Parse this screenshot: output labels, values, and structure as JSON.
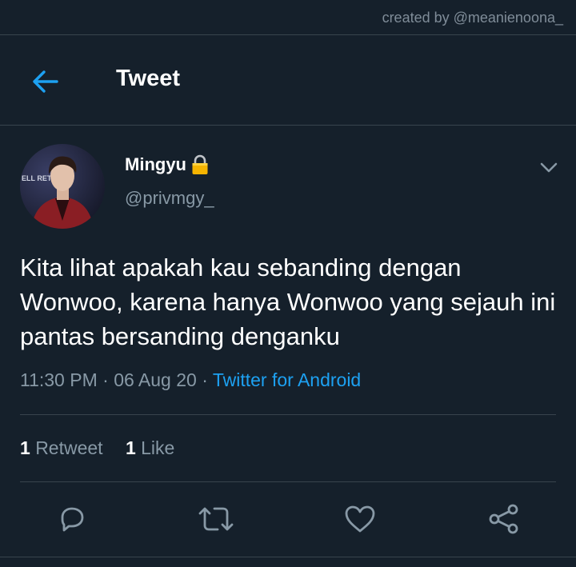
{
  "watermark": "created by @meanienoona_",
  "header": {
    "title": "Tweet",
    "back_icon": "arrow-left-icon"
  },
  "user": {
    "name": "Mingyu",
    "badge_icon": "lock-icon",
    "handle": "@privmgy_",
    "avatar_backdrop_text": "ELL RETU"
  },
  "tweet": {
    "text": "Kita lihat apakah kau sebanding dengan Wonwoo, karena hanya Wonwoo yang sejauh ini pantas bersanding denganku",
    "time": "11:30 PM",
    "date": "06 Aug 20",
    "separator": "·",
    "source": "Twitter for Android"
  },
  "stats": {
    "retweets_count": "1",
    "retweets_label": "Retweet",
    "likes_count": "1",
    "likes_label": "Like"
  },
  "actions": [
    "reply-icon",
    "retweet-icon",
    "like-icon",
    "share-icon"
  ],
  "colors": {
    "background": "#15202b",
    "accent": "#1da1f2",
    "secondary_text": "#8899a6",
    "divider": "#38444d"
  }
}
